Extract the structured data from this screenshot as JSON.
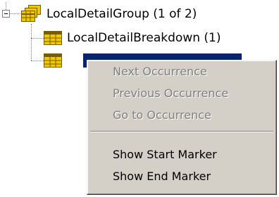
{
  "tree": {
    "root": {
      "label": "LocalDetailGroup (1 of 2)",
      "icon": "group-table-icon",
      "expanded": true
    },
    "children": [
      {
        "label": "LocalDetailBreakdown (1)",
        "icon": "table-icon"
      },
      {
        "label": "",
        "icon": "table-icon",
        "selected": true
      }
    ]
  },
  "context_menu": {
    "items": [
      {
        "label": "Next Occurrence",
        "enabled": false
      },
      {
        "label": "Previous Occurrence",
        "enabled": false
      },
      {
        "label": "Go to Occurrence",
        "enabled": false
      },
      {
        "label": "Show Start Marker",
        "enabled": true
      },
      {
        "label": "Show End Marker",
        "enabled": true
      }
    ]
  },
  "colors": {
    "selection": "#0a246a",
    "menu_bg": "#d4d0c8",
    "disabled_text": "#808080",
    "icon_yellow": "#f0c800",
    "icon_brown": "#7a5a00"
  }
}
